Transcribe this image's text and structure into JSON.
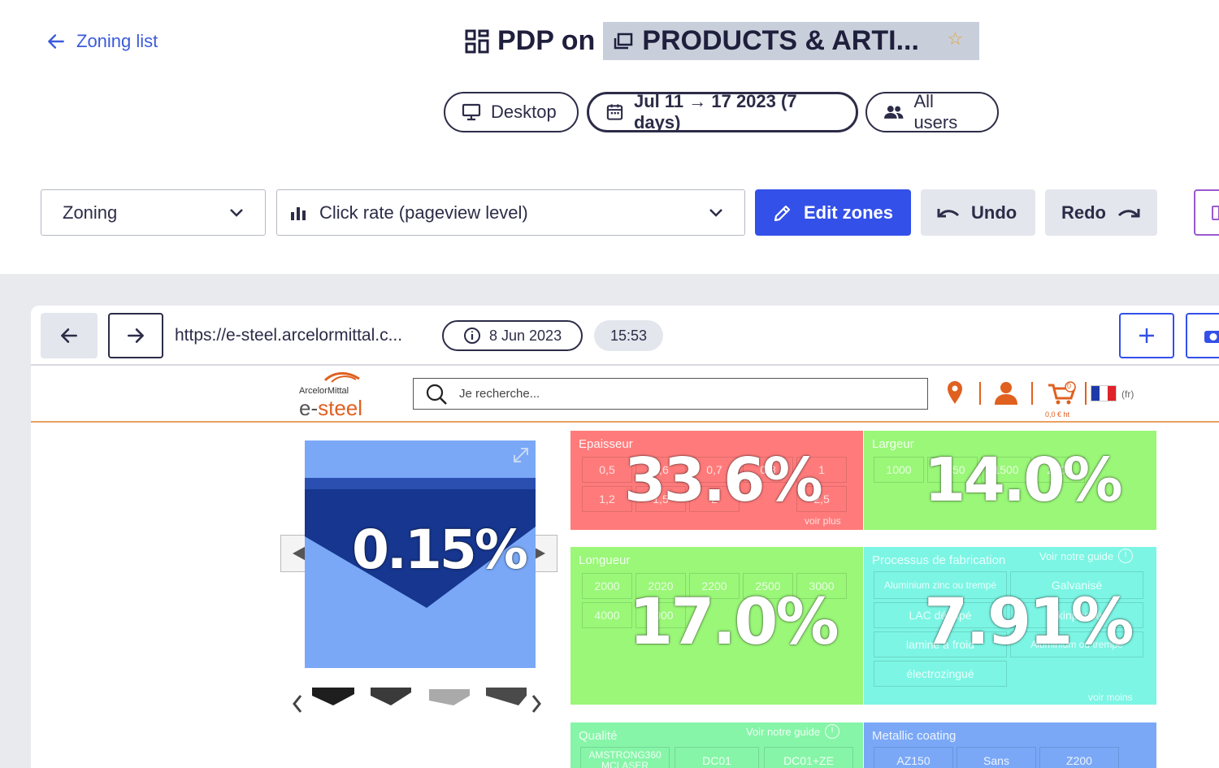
{
  "header": {
    "back_label": "Zoning list",
    "title_prefix": "PDP on",
    "title_tag": "PRODUCTS & ARTI...",
    "filters": {
      "device": "Desktop",
      "date_range": "Jul 11 → 17 2023 (7 days)",
      "segment": "All users"
    }
  },
  "toolbar": {
    "mode_select": "Zoning",
    "metric_select": "Click rate (pageview level)",
    "edit_zones": "Edit zones",
    "undo": "Undo",
    "redo": "Redo"
  },
  "browser": {
    "url": "https://e-steel.arcelormittal.c...",
    "snapshot_date": "8 Jun 2023",
    "snapshot_time": "15:53"
  },
  "site": {
    "logo_top": "ArcelorMittal",
    "logo_main_a": "e-",
    "logo_main_b": "steel",
    "search_placeholder": "Je recherche...",
    "cart_badge": "0",
    "cart_amount": "0,0 € ht",
    "lang": "(fr)"
  },
  "zones": {
    "image": {
      "pct": "0.15%"
    },
    "epaisseur": {
      "title": "Epaisseur",
      "pct": "33.6%",
      "chips": [
        "0,5",
        "0,6",
        "0,7",
        "0,8",
        "1",
        "1,2",
        "1,5",
        "2",
        "2,5"
      ],
      "more": "voir plus"
    },
    "largeur": {
      "title": "Largeur",
      "pct": "14.0%",
      "chips": [
        "1000",
        "1250",
        "1500",
        "2000"
      ]
    },
    "longueur": {
      "title": "Longueur",
      "pct": "17.0%",
      "chips": [
        "2000",
        "2020",
        "2200",
        "2500",
        "3000",
        "4000",
        "6000"
      ]
    },
    "processus": {
      "title": "Processus de fabrication",
      "guide": "Voir notre guide",
      "pct": "7.91%",
      "chips": [
        "Aluminium zinc ou trempé",
        "Galvanisé",
        "LAC décapé",
        "skinpassé",
        "laminé à froid",
        "Aluminium ou trempé",
        "électrozingué"
      ],
      "less": "voir moins"
    },
    "qualite": {
      "title": "Qualité",
      "guide": "Voir notre guide",
      "chips": [
        "AMSTRONG360 MCLASER",
        "DC01",
        "DC01+ZE"
      ]
    },
    "metallic": {
      "title": "Metallic coating",
      "chips": [
        "AZ150",
        "Sans",
        "Z200"
      ]
    }
  },
  "colors": {
    "accent": "#3350e8",
    "zone_red": "#ff7b7b",
    "zone_green": "#9af778",
    "zone_teal": "#7cf5e4",
    "zone_blue": "#7aa8f7"
  }
}
